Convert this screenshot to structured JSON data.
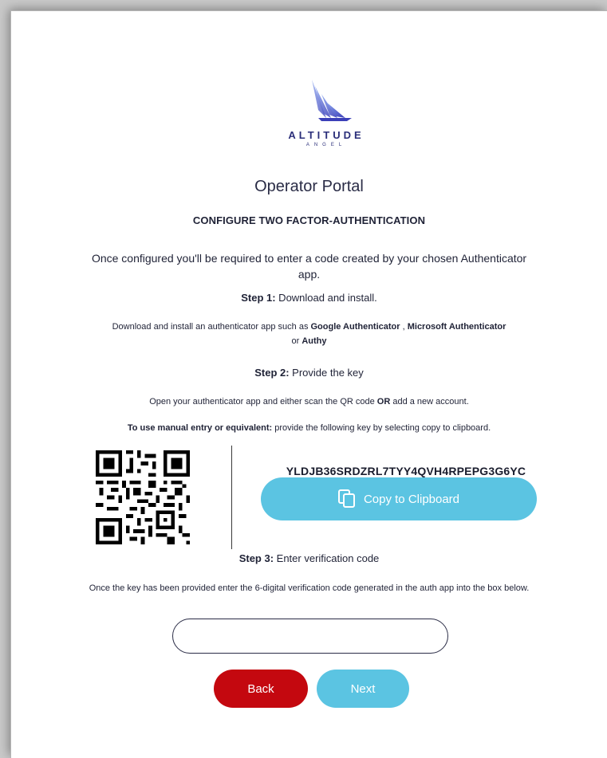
{
  "brand": {
    "name": "ALTITUDE",
    "sub": "ANGEL",
    "logo_icon": "altitude-angel-wing-icon",
    "color": "#2b2f7a"
  },
  "page": {
    "title": "Operator Portal",
    "heading": "CONFIGURE TWO FACTOR-AUTHENTICATION",
    "intro": "Once configured you'll be required to enter a code created by your chosen Authenticator app."
  },
  "step1": {
    "label": "Step 1:",
    "text": " Download and install.",
    "desc_prefix": "Download and install an authenticator app such as ",
    "app1": "Google Authenticator",
    "sep1": " , ",
    "app2": "Microsoft Authenticator",
    "sep2": " or ",
    "app3": "Authy"
  },
  "step2": {
    "label": "Step 2:",
    "text": " Provide the key",
    "desc_a": "Open your authenticator app and either scan the QR code ",
    "desc_or": "OR",
    "desc_b": " add a new account.",
    "manual_label": "To use manual entry or equivalent:",
    "manual_text": " provide the following key by selecting copy to clipboard.",
    "key": "YLDJB36SRDZRL7TYY4QVH4RPEPG3G6YC",
    "copy_label": "Copy to Clipboard",
    "copy_icon": "copy-icon"
  },
  "step3": {
    "label": "Step 3:",
    "text": " Enter verification code",
    "desc": "Once the key has been provided enter the 6-digital verification code generated in the auth app into the box below.",
    "input_value": ""
  },
  "actions": {
    "back": "Back",
    "next": "Next"
  },
  "colors": {
    "accent": "#5bc4e2",
    "danger": "#c4080f",
    "text": "#1f2236"
  }
}
